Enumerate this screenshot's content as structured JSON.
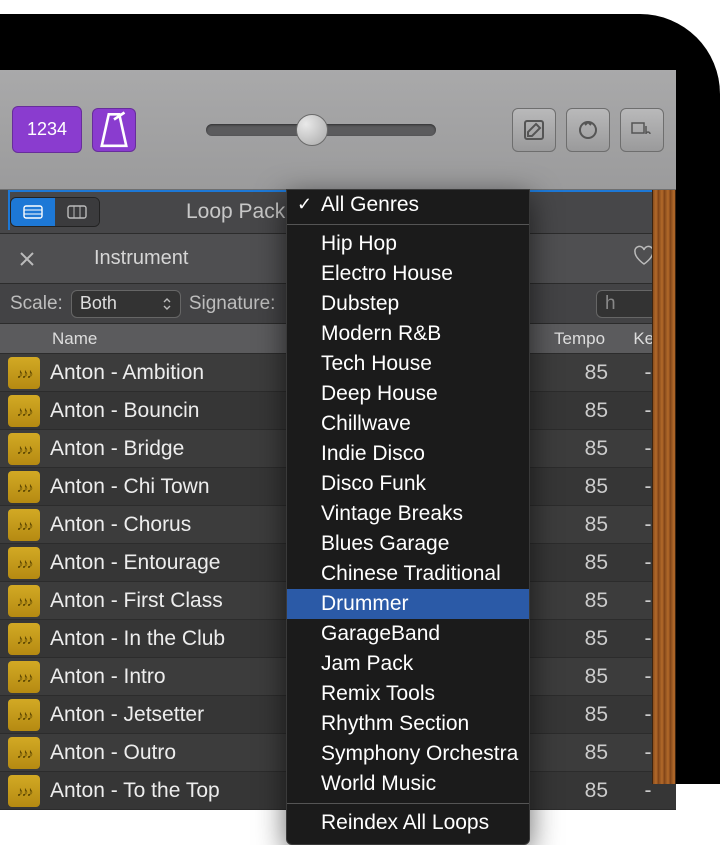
{
  "toolbar": {
    "count_label": "1234",
    "edit_icon": "edit-icon",
    "loop_icon": "loop-icon",
    "media_icon": "media-icon"
  },
  "browser": {
    "title": "Loop Pack",
    "tab_label": "Instrument",
    "scale_label": "Scale:",
    "scale_value": "Both",
    "signature_label": "Signature:",
    "search_tail": "h",
    "columns": {
      "name": "Name",
      "tempo": "Tempo",
      "key": "Key"
    },
    "rows": [
      {
        "name": "Anton - Ambition",
        "tempo": "85",
        "key": "-"
      },
      {
        "name": "Anton - Bouncin",
        "tempo": "85",
        "key": "-"
      },
      {
        "name": "Anton - Bridge",
        "tempo": "85",
        "key": "-"
      },
      {
        "name": "Anton - Chi Town",
        "tempo": "85",
        "key": "-"
      },
      {
        "name": "Anton - Chorus",
        "tempo": "85",
        "key": "-"
      },
      {
        "name": "Anton - Entourage",
        "tempo": "85",
        "key": "-"
      },
      {
        "name": "Anton - First Class",
        "tempo": "85",
        "key": "-"
      },
      {
        "name": "Anton - In the Club",
        "tempo": "85",
        "key": "-"
      },
      {
        "name": "Anton - Intro",
        "tempo": "85",
        "key": "-"
      },
      {
        "name": "Anton - Jetsetter",
        "tempo": "85",
        "key": "-"
      },
      {
        "name": "Anton - Outro",
        "tempo": "85",
        "key": "-"
      },
      {
        "name": "Anton - To the Top",
        "tempo": "85",
        "key": "-"
      }
    ]
  },
  "menu": {
    "checked": "All Genres",
    "highlighted": "Drummer",
    "items_top": [
      "All Genres"
    ],
    "items_main": [
      "Hip Hop",
      "Electro House",
      "Dubstep",
      "Modern R&B",
      "Tech House",
      "Deep House",
      "Chillwave",
      "Indie Disco",
      "Disco Funk",
      "Vintage Breaks",
      "Blues Garage",
      "Chinese Traditional",
      "Drummer",
      "GarageBand",
      "Jam Pack",
      "Remix Tools",
      "Rhythm Section",
      "Symphony Orchestra",
      "World Music"
    ],
    "items_bottom": [
      "Reindex All Loops"
    ]
  }
}
